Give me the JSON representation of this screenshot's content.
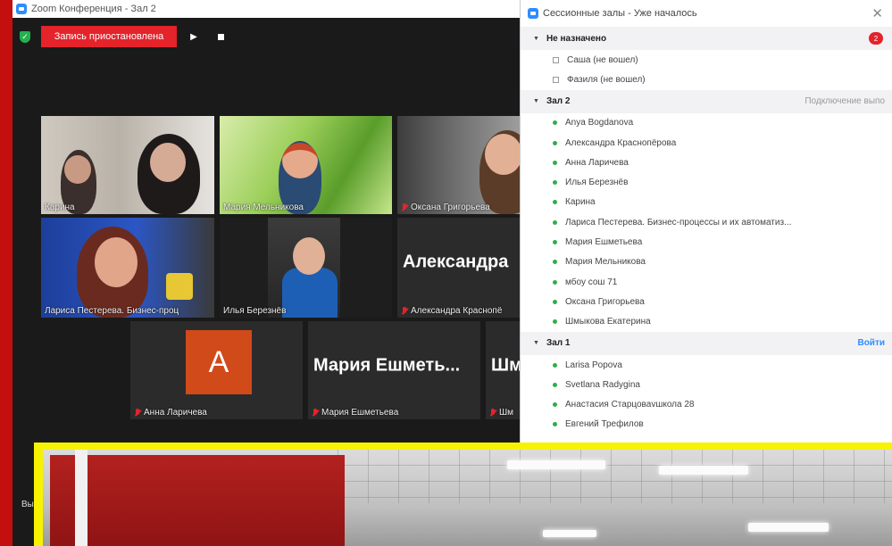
{
  "window": {
    "title": "Zoom Конференция - Зал 2"
  },
  "toolbar": {
    "recording_label": "Запись приостановлена"
  },
  "tiles": [
    {
      "name": "Карина"
    },
    {
      "name": "Мария Мельникова"
    },
    {
      "name": "Оксана Григорьева"
    },
    {
      "name": "Лариса Пестерева. Бизнес-проц"
    },
    {
      "name": "Илья Березнёв"
    },
    {
      "name": "Александра Краснопё",
      "big": "Александра"
    },
    {
      "name": "Анна Ларичева",
      "avatar": "А"
    },
    {
      "name": "Мария Ешметьева",
      "big": "Мария Ешметь..."
    },
    {
      "name": "Шм",
      "big": "Шм"
    }
  ],
  "side_partial": "Вы",
  "panel": {
    "title": "Сессионные залы - Уже началось",
    "groups": [
      {
        "name": "Не назначено",
        "badge": "2",
        "members": [
          "Саша (не вошел)",
          "Фазиля (не вошел)"
        ]
      },
      {
        "name": "Зал 2",
        "action": "Подключение выпо",
        "members": [
          "Anya Bogdanova",
          "Александра Краснопёрова",
          "Анна Ларичева",
          "Илья Березнёв",
          "Карина",
          "Лариса Пестерева. Бизнес-процессы и их автоматиз...",
          "Мария Ешметьева",
          "Мария Мельникова",
          "мбоу сош 71",
          "Оксана Григорьева",
          "Шмыкова Екатерина"
        ]
      },
      {
        "name": "Зал 1",
        "action": "Войти",
        "members": [
          "Larisa Popova",
          "Svetlana Radygina",
          "Анастасия Старцоваvшкола 28",
          "Евгений Трефилов"
        ]
      }
    ]
  },
  "colors": {
    "accent": "#2d8cff",
    "record": "#e4232b",
    "online": "#2fad4a",
    "frame_red": "#c40f0f",
    "frame_yellow": "#f7f200"
  }
}
